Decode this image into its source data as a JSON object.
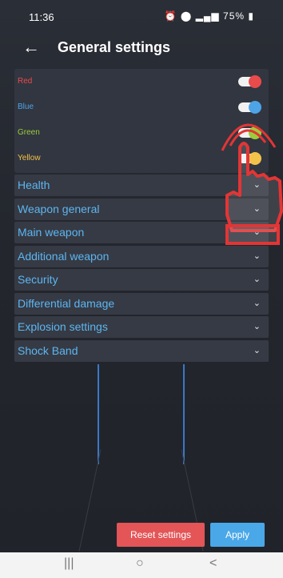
{
  "status": {
    "time": "11:36",
    "right": "75%"
  },
  "appbar": {
    "title": "General settings"
  },
  "colors": [
    {
      "label": "Red",
      "color": "#e84b4b"
    },
    {
      "label": "Blue",
      "color": "#4da4e6"
    },
    {
      "label": "Green",
      "color": "#9ccc3b"
    },
    {
      "label": "Yellow",
      "color": "#f3c24a"
    }
  ],
  "sections": [
    {
      "label": "Health"
    },
    {
      "label": "Weapon general"
    },
    {
      "label": "Main weapon"
    },
    {
      "label": "Additional weapon"
    },
    {
      "label": "Security"
    },
    {
      "label": "Differential damage"
    },
    {
      "label": "Explosion settings"
    },
    {
      "label": "Shock Band"
    }
  ],
  "section_color": "#5cb6f2",
  "actions": {
    "reset": "Reset settings",
    "apply": "Apply"
  },
  "icons": {
    "back": "←",
    "chevron": "⌄",
    "nav_recent": "|||",
    "nav_home": "○",
    "nav_back": "<"
  }
}
